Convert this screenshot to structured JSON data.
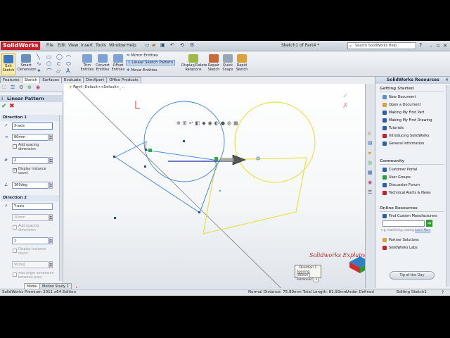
{
  "app": {
    "logo": "SolidWorks",
    "title": "Sketch1 of Part4 *",
    "search_placeholder": "Search SolidWorks Help",
    "menu": [
      "File",
      "Edit",
      "View",
      "Insert",
      "Tools",
      "Window",
      "Help"
    ]
  },
  "ribbon": {
    "buttons": [
      {
        "label": "Exit Sketch"
      },
      {
        "label": "Smart Dimension"
      },
      {
        "label": "Trim Entities"
      },
      {
        "label": "Convert Entities"
      },
      {
        "label": "Offset Entities"
      },
      {
        "label": "Display/Delete Relations"
      },
      {
        "label": "Repair Sketch"
      },
      {
        "label": "Quick Snaps"
      },
      {
        "label": "Rapid Sketch"
      }
    ],
    "small_buttons": [
      "Mirror Entities",
      "Linear Sketch Pattern",
      "Move Entities"
    ]
  },
  "tabs": [
    "Features",
    "Sketch",
    "Surfaces",
    "Evaluate",
    "DimXpert",
    "Office Products"
  ],
  "tabs_active": "Sketch",
  "feature_tree_label": "Part4  (Default<<Default>_...",
  "property_manager": {
    "title": "Linear Pattern",
    "direction1": {
      "header": "Direction 1",
      "axis": "X-axis",
      "spacing": "80mm",
      "add_spacing_dimension": "Add spacing dimension",
      "count": "2",
      "display_instance_count": "Display instance count",
      "angle": "360deg"
    },
    "direction2": {
      "header": "Direction 2",
      "axis": "Y-axis",
      "spacing": "10mm",
      "add_spacing_dimension": "Add spacing dimension",
      "count": "1",
      "display_instance_count": "Display instance count",
      "angle": "90deg",
      "add_angle_dimension": "Add angle dimension between axes"
    }
  },
  "canvas_callout": {
    "title": "Direction 1",
    "spacing_label": "Spacing:",
    "spacing_value": "80mm",
    "instances_label": "Instances:",
    "instances_value": "2"
  },
  "resources": {
    "title": "SolidWorks Resources",
    "getting_started": {
      "header": "Getting Started",
      "items": [
        "New Document",
        "Open a Document",
        "Making My First Part",
        "Making My First Drawing",
        "Tutorials",
        "Introducing SolidWorks",
        "General Information"
      ]
    },
    "community": {
      "header": "Community",
      "items": [
        "Customer Portal",
        "User Groups",
        "Discussion Forum",
        "Technical Alerts & News"
      ]
    },
    "online": {
      "header": "Online Resources",
      "find_label": "Find Custom Manufacturers",
      "find_hint": "e.g. machining, casting",
      "learn_more": "Learn More",
      "items": [
        "Partner Solutions",
        "SolidWorks Labs"
      ]
    },
    "tip": "Tip of the Day"
  },
  "watermark": "Solidworks Explained",
  "bottom_tabs": [
    "Model",
    "Motion Study 1"
  ],
  "status": {
    "edition": "SolidWorks Premium 2011 x64 Edition",
    "measure": "Normal Distance: 75.89mm Total Length: 81.93mm",
    "state": "Under Defined",
    "editing": "Editing Sketch1"
  },
  "colors": {
    "sketch_blue": "#3b7fe0",
    "preview_yellow": "#e8e24a",
    "logo_red": "#c8202a",
    "accept_green": "#2e9b2e",
    "cancel_red": "#cc2222"
  }
}
